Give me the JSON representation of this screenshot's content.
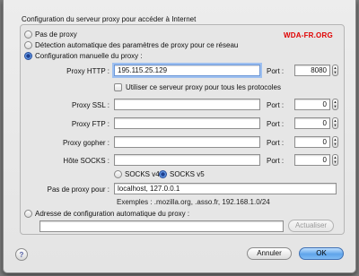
{
  "dialog": {
    "title": "Configuration du serveur proxy pour accéder à Internet",
    "watermark": "WDA-FR.ORG"
  },
  "modes": [
    {
      "label": "Pas de proxy",
      "selected": false
    },
    {
      "label": "Détection automatique des paramètres de proxy pour ce réseau",
      "selected": false
    },
    {
      "label": "Configuration manuelle du proxy :",
      "selected": true
    }
  ],
  "http": {
    "label": "Proxy HTTP :",
    "value": "195.115.25.129",
    "port_label": "Port :",
    "port": "8080"
  },
  "same_proxy": {
    "label": "Utiliser ce serveur proxy pour tous les protocoles",
    "checked": false
  },
  "ssl": {
    "label": "Proxy SSL :",
    "value": "",
    "port_label": "Port :",
    "port": "0"
  },
  "ftp": {
    "label": "Proxy FTP :",
    "value": "",
    "port_label": "Port :",
    "port": "0"
  },
  "gopher": {
    "label": "Proxy gopher :",
    "value": "",
    "port_label": "Port :",
    "port": "0"
  },
  "socks": {
    "label": "Hôte SOCKS :",
    "value": "",
    "port_label": "Port :",
    "port": "0"
  },
  "socks_version": [
    {
      "label": "SOCKS v4",
      "selected": false
    },
    {
      "label": "SOCKS v5",
      "selected": true
    }
  ],
  "no_proxy": {
    "label": "Pas de proxy pour :",
    "value": "localhost, 127.0.0.1",
    "hint": "Exemples : .mozilla.org, .asso.fr, 192.168.1.0/24"
  },
  "auto_config": {
    "label": "Adresse de configuration automatique du proxy :",
    "value": "",
    "reload_label": "Actualiser"
  },
  "footer": {
    "help_label": "?",
    "cancel_label": "Annuler",
    "ok_label": "OK"
  }
}
